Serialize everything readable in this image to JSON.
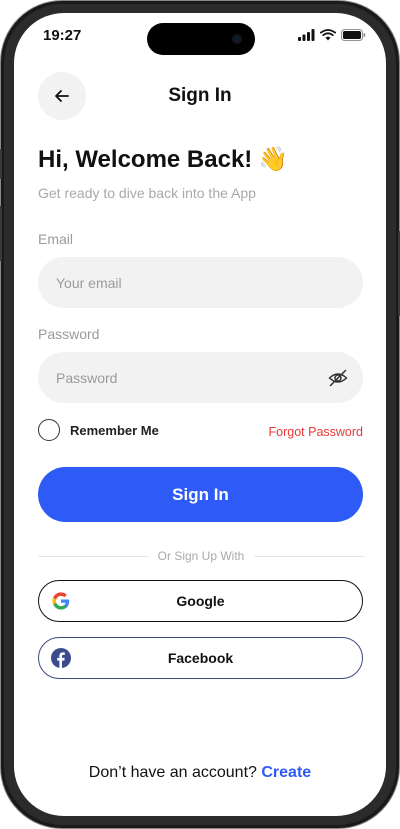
{
  "status_bar": {
    "time": "19:27",
    "icons": [
      "signal-icon",
      "wifi-icon",
      "battery-icon"
    ]
  },
  "header": {
    "back_icon": "arrow-left-icon",
    "title": "Sign In"
  },
  "welcome": {
    "title": "Hi, Welcome Back!",
    "emoji": "👋",
    "subtitle": "Get ready to dive back into the App"
  },
  "form": {
    "email_label": "Email",
    "email_placeholder": "Your email",
    "password_label": "Password",
    "password_placeholder": "Password",
    "password_toggle_icon": "eye-off-icon",
    "remember_label": "Remember Me",
    "forgot_label": "Forgot Password",
    "submit_label": "Sign In"
  },
  "social": {
    "divider_text": "Or Sign Up With",
    "google_label": "Google",
    "facebook_label": "Facebook"
  },
  "footer": {
    "prompt": "Don’t have an account?",
    "create_label": "Create"
  },
  "colors": {
    "primary": "#2e5bf5",
    "danger": "#e53935",
    "field_bg": "#f2f2f2"
  }
}
